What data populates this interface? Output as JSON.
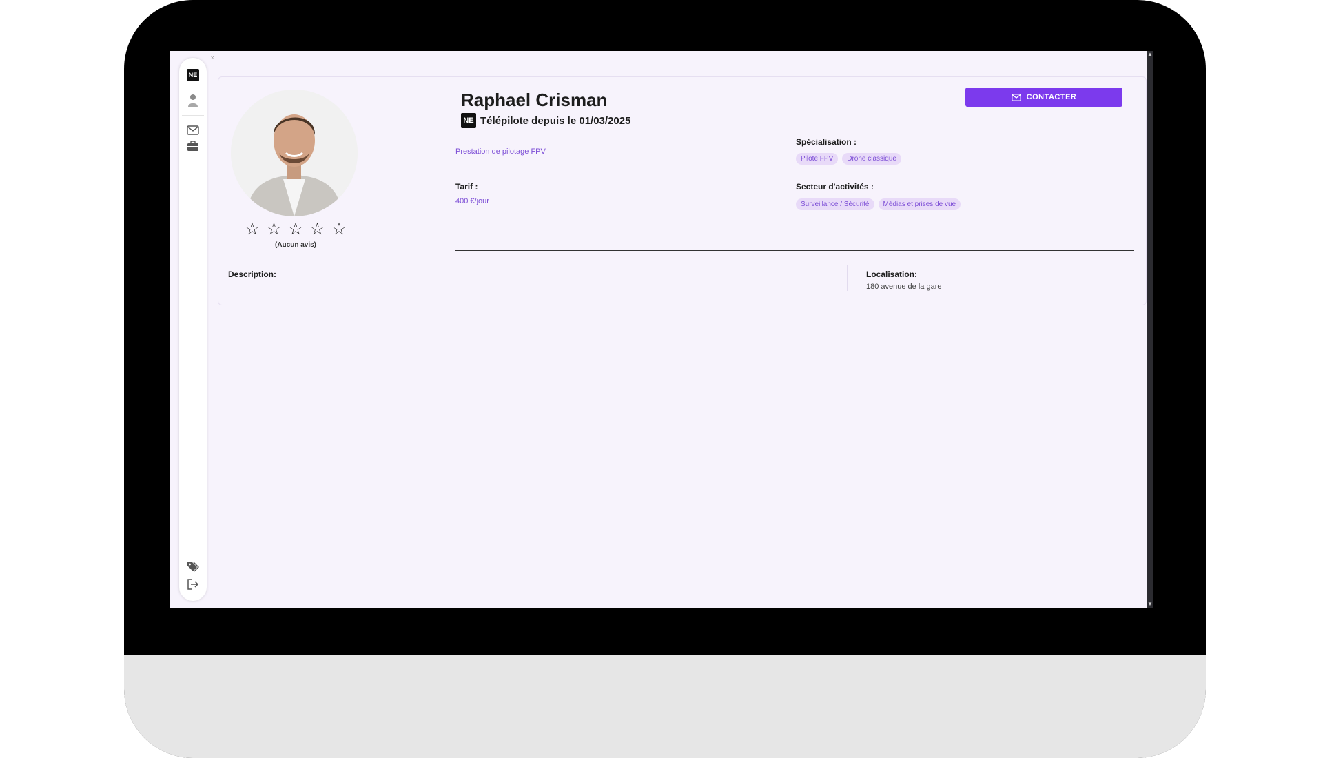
{
  "window": {
    "corner_mark": "x"
  },
  "sidebar": {
    "items": [
      {
        "name": "logo",
        "icon": "ne-logo",
        "label": "NE"
      },
      {
        "name": "profile",
        "icon": "user-icon"
      },
      {
        "name": "messages",
        "icon": "mail-icon"
      },
      {
        "name": "missions",
        "icon": "briefcase-icon"
      },
      {
        "name": "tags",
        "icon": "tags-icon"
      },
      {
        "name": "logout",
        "icon": "logout-icon"
      }
    ]
  },
  "profile": {
    "name": "Raphael Crisman",
    "badge": "NE",
    "since": "Télépilote depuis le 01/03/2025",
    "rating": {
      "value": 0,
      "max": 5,
      "label": "(Aucun avis)"
    },
    "service": "Prestation de pilotage FPV",
    "tarif_label": "Tarif :",
    "tarif_value": "400 €/jour",
    "specialisation_label": "Spécialisation :",
    "specialisations": [
      "Pilote FPV",
      "Drone classique"
    ],
    "secteur_label": "Secteur d'activités :",
    "secteurs": [
      "Surveillance / Sécurité",
      "Médias et prises de vue"
    ],
    "description_label": "Description:",
    "localisation_label": "Localisation:",
    "localisation_value": "180 avenue de la gare"
  },
  "actions": {
    "contact_label": "CONTACTER"
  },
  "colors": {
    "accent": "#7c3aed",
    "tag_bg": "#e8daf8",
    "tag_text": "#7c4dd6",
    "page_bg": "#f7f3fc"
  }
}
